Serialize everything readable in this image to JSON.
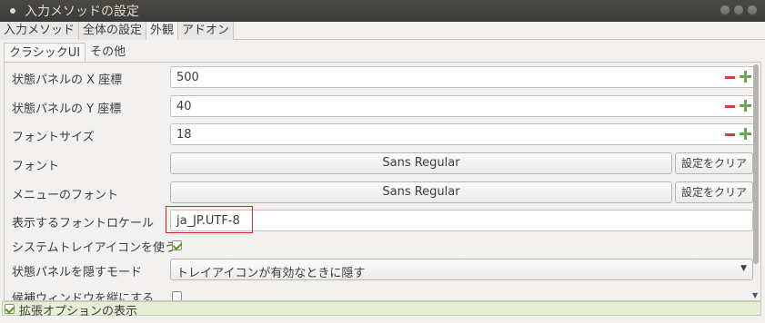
{
  "window": {
    "title": "入力メソッドの設定"
  },
  "tabs": [
    {
      "label": "入力メソッド"
    },
    {
      "label": "全体の設定"
    },
    {
      "label": "外観"
    },
    {
      "label": "アドオン"
    }
  ],
  "subtabs": [
    {
      "label": "クラシックUI"
    },
    {
      "label": "その他"
    }
  ],
  "settings": {
    "panel_x": {
      "label": "状態パネルの X 座標",
      "value": "500"
    },
    "panel_y": {
      "label": "状態パネルの Y 座標",
      "value": "40"
    },
    "font_size": {
      "label": "フォントサイズ",
      "value": "18"
    },
    "font": {
      "label": "フォント",
      "value": "Sans Regular",
      "clear_label": "設定をクリア"
    },
    "menu_font": {
      "label": "メニューのフォント",
      "value": "Sans Regular",
      "clear_label": "設定をクリア"
    },
    "font_locale": {
      "label": "表示するフォントロケール",
      "value": "ja_JP.UTF-8"
    },
    "use_tray": {
      "label": "システムトレイアイコンを使う",
      "checked": true
    },
    "hide_panel": {
      "label": "状態パネルを隠すモード",
      "value": "トレイアイコンが有効なときに隠す"
    },
    "vertical_candidate": {
      "label": "候補ウィンドウを縦にする",
      "checked": false
    }
  },
  "footer": {
    "label": "拡張オプションの表示",
    "checked": true
  },
  "colors": {
    "highlight": "#d9232c",
    "minus": "#e0393e",
    "plus": "#6aa84f"
  }
}
